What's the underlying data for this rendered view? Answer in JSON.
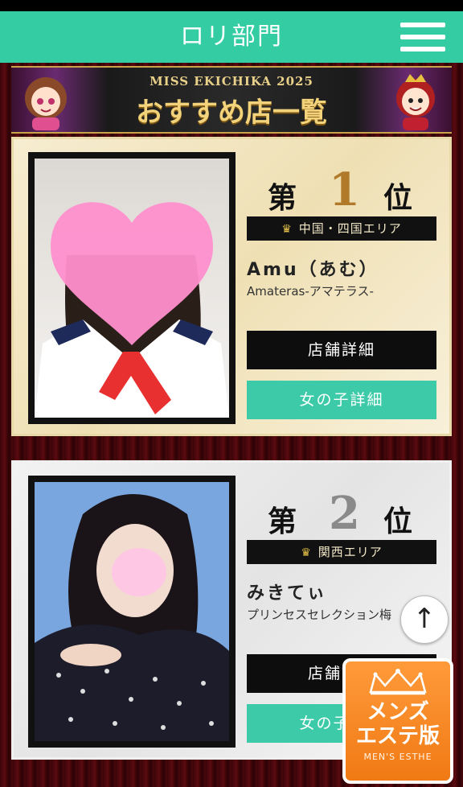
{
  "header": {
    "title": "ロリ部門",
    "menu_icon": "hamburger-menu-icon"
  },
  "banner": {
    "subtitle": "MISS EKICHIKA 2025",
    "title": "おすすめ店一覧"
  },
  "rankings": [
    {
      "prefix": "第",
      "rank": "1",
      "suffix": "位",
      "rank_color": "#b07a2a",
      "area": "中国・四国エリア",
      "name": "Amu（あむ）",
      "shop": "Amateras-アマテラス-",
      "shop_button": "店舗詳細",
      "girl_button": "女の子詳細"
    },
    {
      "prefix": "第",
      "rank": "2",
      "suffix": "位",
      "rank_color": "#8a8a8a",
      "area": "関西エリア",
      "name": "みきてぃ",
      "shop": "プリンセスセレクション梅",
      "shop_button": "店舗詳細",
      "girl_button": "女の子詳細"
    }
  ],
  "scroll_top": {
    "label": "↑"
  },
  "mens_esthe": {
    "line1": "メンズ",
    "line2": "エステ版",
    "line3": "MEN'S ESTHE"
  },
  "colors": {
    "accent": "#33cca3",
    "button_dark": "#0d0d0d",
    "button_teal": "#3ccaa8",
    "badge": "#f07a14"
  }
}
